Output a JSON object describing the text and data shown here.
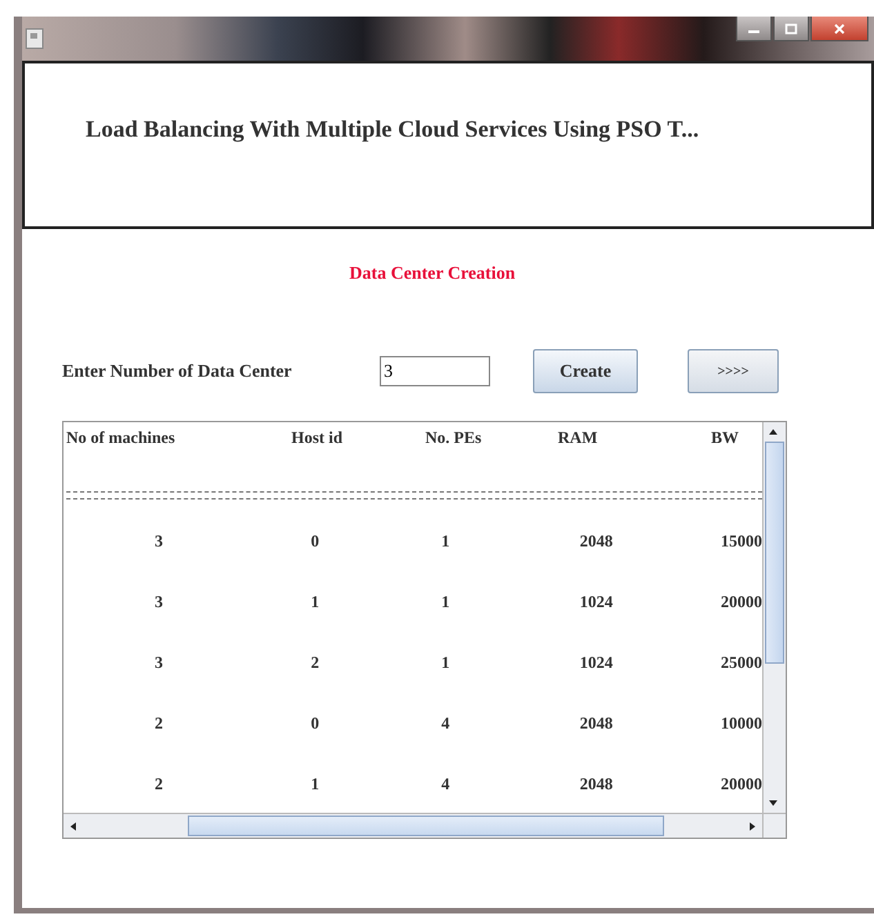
{
  "window": {
    "title": "Load Balancing With Multiple Cloud Services Using PSO T..."
  },
  "section_title": "Data Center Creation",
  "form": {
    "label": "Enter Number of Data Center",
    "value": "3",
    "buttons": [
      "Create",
      ">>>>"
    ]
  },
  "table": {
    "columns": [
      "No of machines",
      "Host id",
      "No. PEs",
      "RAM",
      "BW"
    ],
    "rows": [
      [
        "3",
        "0",
        "1",
        "2048",
        "15000"
      ],
      [
        "3",
        "1",
        "1",
        "1024",
        "20000"
      ],
      [
        "3",
        "2",
        "1",
        "1024",
        "25000"
      ],
      [
        "2",
        "0",
        "4",
        "2048",
        "10000"
      ],
      [
        "2",
        "1",
        "4",
        "2048",
        "20000"
      ]
    ]
  }
}
